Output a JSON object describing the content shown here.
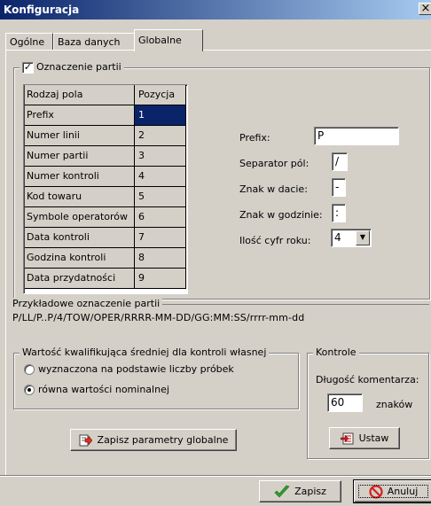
{
  "window": {
    "title": "Konfiguracja",
    "close_label": "×"
  },
  "tabs": [
    {
      "label": "Ogólne"
    },
    {
      "label": "Baza danych"
    },
    {
      "label": "Globalne"
    }
  ],
  "oznaczenie": {
    "checkbox_label": "Oznaczenie partii",
    "checked": true,
    "check_mark": "✓",
    "grid": {
      "headers": [
        "Rodzaj pola",
        "Pozycja"
      ],
      "rows": [
        [
          "Prefix",
          "1"
        ],
        [
          "Numer linii",
          "2"
        ],
        [
          "Numer partii",
          "3"
        ],
        [
          "Numer kontroli",
          "4"
        ],
        [
          "Kod towaru",
          "5"
        ],
        [
          "Symbole operatorów",
          "6"
        ],
        [
          "Data kontroli",
          "7"
        ],
        [
          "Godzina kontroli",
          "8"
        ],
        [
          "Data przydatności",
          "9"
        ]
      ],
      "selected_row": 0
    },
    "fields": {
      "prefix_label": "Prefix:",
      "prefix_value": "P",
      "separator_label": "Separator pól:",
      "separator_value": "/",
      "date_sign_label": "Znak w dacie:",
      "date_sign_value": "-",
      "time_sign_label": "Znak w godzinie:",
      "time_sign_value": ":",
      "year_digits_label": "Ilość cyfr roku:",
      "year_digits_value": "4"
    }
  },
  "example": {
    "label": "Przykładowe oznaczenie partii",
    "value": "P/LL/P..P/4/TOW/OPER/RRRR-MM-DD/GG:MM:SS/rrrr-mm-dd"
  },
  "qualifier": {
    "legend": "Wartość kwalifikująca średniej dla kontroli własnej",
    "options": [
      {
        "label": "wyznaczona na podstawie liczby próbek",
        "selected": false
      },
      {
        "label": "równa wartości nominalnej",
        "selected": true
      }
    ]
  },
  "kontrole": {
    "legend": "Kontrole",
    "comment_length_label": "Długość komentarza:",
    "comment_length_value": "60",
    "unit_label": "znaków",
    "set_button": "Ustaw"
  },
  "save_globals_button": "Zapisz parametry globalne",
  "footer": {
    "save_button": "Zapisz",
    "cancel_button": "Anuluj"
  },
  "colors": {
    "face": "#d4d0c8",
    "title_start": "#0a246a",
    "title_end": "#a6caf0",
    "selection": "#0a246a",
    "ok_green": "#2e9e2e",
    "cancel_red": "#d42020"
  }
}
